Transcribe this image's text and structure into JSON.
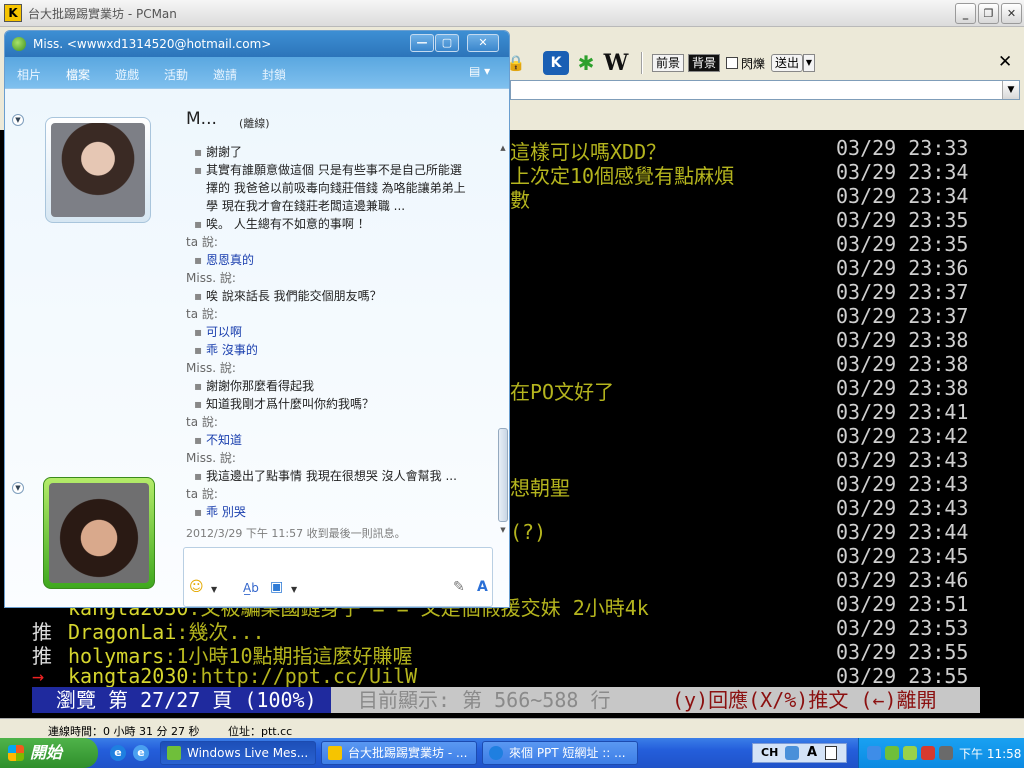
{
  "pcman": {
    "title": "台大批踢踢實業坊 - PCMan",
    "app_icon": "K",
    "controls": {
      "minimize": "_",
      "maximize": "❐",
      "close": "✕"
    },
    "toolbar": {
      "fore_label": "前景",
      "back_label": "背景",
      "blink_label": "閃爍",
      "send_label": "送出",
      "w_icon": "W"
    },
    "status": {
      "connected": "連線時間：0 小時 31 分 27 秒",
      "address": "位址：ptt.cc"
    }
  },
  "terminal": {
    "rows": [
      {
        "msg": "這樣可以嗎XDD？",
        "time": "03/29 23:33"
      },
      {
        "msg": "上次定10個感覺有點麻煩",
        "time": "03/29 23:34"
      },
      {
        "msg": "數",
        "time": "03/29 23:34"
      },
      {
        "msg": "",
        "time": "03/29 23:35"
      },
      {
        "msg": "",
        "time": "03/29 23:35"
      },
      {
        "msg": "",
        "time": "03/29 23:36"
      },
      {
        "msg": "",
        "time": "03/29 23:37"
      },
      {
        "msg": "",
        "time": "03/29 23:37"
      },
      {
        "msg": "",
        "time": "03/29 23:38"
      },
      {
        "msg": "",
        "time": "03/29 23:38"
      },
      {
        "msg": "在PO文好了",
        "time": "03/29 23:38"
      },
      {
        "msg": "",
        "time": "03/29 23:41"
      },
      {
        "msg": "",
        "time": "03/29 23:42"
      },
      {
        "msg": "",
        "time": "03/29 23:43"
      },
      {
        "msg": "想朝聖",
        "time": "03/29 23:43"
      },
      {
        "msg": "",
        "time": "03/29 23:43"
      },
      {
        "msg": "(?)",
        "time": "03/29 23:44"
      },
      {
        "msg": "",
        "time": "03/29 23:45"
      },
      {
        "msg": "",
        "time": "03/29 23:46"
      }
    ],
    "full_rows": [
      {
        "tag": "",
        "user": "kangta2030",
        "body": ":又被騙桌國鏈身子 = = 又是個假援交妹 2小時4k",
        "time": "03/29 23:51"
      },
      {
        "tag": "推",
        "user": "DragonLai",
        "body": ":幾次...",
        "time": "03/29 23:53"
      },
      {
        "tag": "推",
        "user": "holymars",
        "body": ":1小時10點期指這麼好賺喔",
        "time": "03/29 23:55"
      },
      {
        "tag": "→",
        "user": "kangta2030",
        "body": ":http://ppt.cc/UilW",
        "time": "03/29 23:55"
      }
    ],
    "statusbar": {
      "browse": "瀏覽 第 27/27 頁 (100%)",
      "showing": "目前顯示: 第 566~588 行",
      "hints": "(y)回應(X/%)推文 (←)離開"
    }
  },
  "wlm": {
    "title": "Miss. <wwwxd1314520@hotmail.com>",
    "controls": {
      "minimize": "—",
      "maximize": "▢",
      "close": "✕"
    },
    "menu": [
      {
        "label": "相片",
        "active": false
      },
      {
        "label": "檔案",
        "active": true
      },
      {
        "label": "遊戲",
        "active": false
      },
      {
        "label": "活動",
        "active": false
      },
      {
        "label": "邀請",
        "active": false
      },
      {
        "label": "封鎖",
        "active": false
      }
    ],
    "contact_name": "M...",
    "contact_status": "(離線)",
    "chat": [
      {
        "type": "msg-contact",
        "text": "謝謝了"
      },
      {
        "type": "msg-contact",
        "text": "其實有誰願意做這個 只是有些事不是自己所能選"
      },
      {
        "type": "msg-contact-cont",
        "text": "擇的 我爸爸以前吸毒向錢莊借錢 為咯能讓弟弟上"
      },
      {
        "type": "msg-contact-cont",
        "text": "學 現在我才會在錢莊老闆這邊兼職 ..."
      },
      {
        "type": "msg-contact",
        "text": "唉。 人生總有不如意的事啊 ！"
      },
      {
        "type": "sender",
        "text": "ta 說:"
      },
      {
        "type": "msg-self",
        "text": "恩恩真的"
      },
      {
        "type": "sender",
        "text": "Miss. 說:"
      },
      {
        "type": "msg-contact",
        "text": "唉 說來話長 我們能交個朋友嗎？"
      },
      {
        "type": "sender",
        "text": "ta 說:"
      },
      {
        "type": "msg-self",
        "text": "可以啊"
      },
      {
        "type": "msg-self",
        "text": "乖 沒事的"
      },
      {
        "type": "sender",
        "text": "Miss. 說:"
      },
      {
        "type": "msg-contact",
        "text": "謝謝你那麼看得起我"
      },
      {
        "type": "msg-contact",
        "text": "知道我剛才爲什麼叫你約我嗎？"
      },
      {
        "type": "sender",
        "text": "ta 說:"
      },
      {
        "type": "msg-self",
        "text": "不知道"
      },
      {
        "type": "sender",
        "text": "Miss. 說:"
      },
      {
        "type": "msg-contact",
        "text": "我這邊出了點事情 我現在很想哭 沒人會幫我 ..."
      },
      {
        "type": "sender",
        "text": "ta 說:"
      },
      {
        "type": "msg-self",
        "text": "乖 別哭"
      }
    ],
    "last_message": "2012/3/29 下午 11:57 收到最後一則訊息。",
    "bullet": "▪"
  },
  "taskbar": {
    "start_label": "開始",
    "tasks": [
      {
        "label": "Windows Live Mes..."
      },
      {
        "label": "台大批踢踢實業坊 - ..."
      },
      {
        "label": "來個 PPT 短網址 :: ..."
      }
    ],
    "ime": {
      "lang": "CH",
      "mode": "A"
    },
    "clock": "下午 11:58"
  }
}
